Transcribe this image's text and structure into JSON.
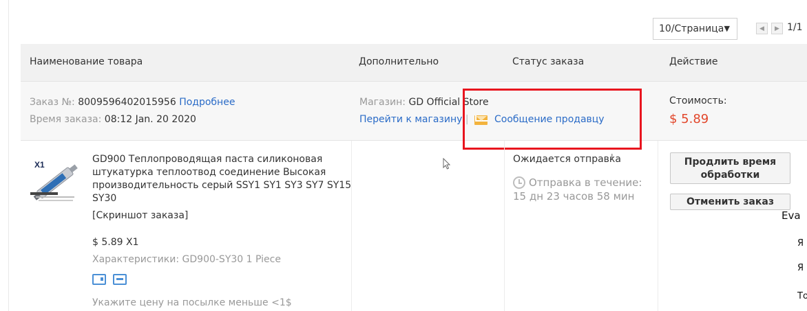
{
  "pagination": {
    "per_page": "10/Страница",
    "prev_icon": "chevron-left-icon",
    "next_icon": "chevron-right-icon",
    "page_count": "1/1"
  },
  "table_header": {
    "product_name": "Наименование товара",
    "additional": "Дополнительно",
    "order_status": "Статус заказа",
    "action": "Действие"
  },
  "order": {
    "number_label": "Заказ №:",
    "number": "8009596402015956",
    "details_link": "Подробнее",
    "time_label": "Время заказа:",
    "time": "08:12 Jan. 20 2020",
    "store_label": "Магазин:",
    "store_name": "GD Official Store",
    "go_to_store": "Перейти к магазину",
    "separator": "|",
    "message_seller": "Сообщение продавцу",
    "cost_label": "Стоимость:",
    "cost": "$ 5.89"
  },
  "product": {
    "thumb_badge": "X1",
    "title": "GD900 Теплопроводящая паста силиконовая штукатурка теплоотвод соединение Высокая производительность серый SSY1 SY1 SY3 SY7 SY15 SY30",
    "snapshot": "[Скриншот заказа]",
    "price_qty": "$ 5.89 X1",
    "specs_label": "Характеристики:",
    "specs_value": "GD900-SY30 1 Piece",
    "note": "Укажите цену на посылке меньше <1$"
  },
  "status": {
    "text": "Ожидается отправка",
    "ship_in_label": "Отправка в течение:",
    "ship_time": "15 дн 23 часов 58 мин"
  },
  "actions": {
    "extend": "Продлить время обработки",
    "cancel": "Отменить заказ"
  },
  "overlay_side": {
    "name": "Eva",
    "line1": "Я",
    "line2": "Я",
    "line3": "То"
  },
  "colors": {
    "accent_link": "#2a6bc7",
    "price": "#e2462a",
    "annotation": "#e8141e"
  }
}
